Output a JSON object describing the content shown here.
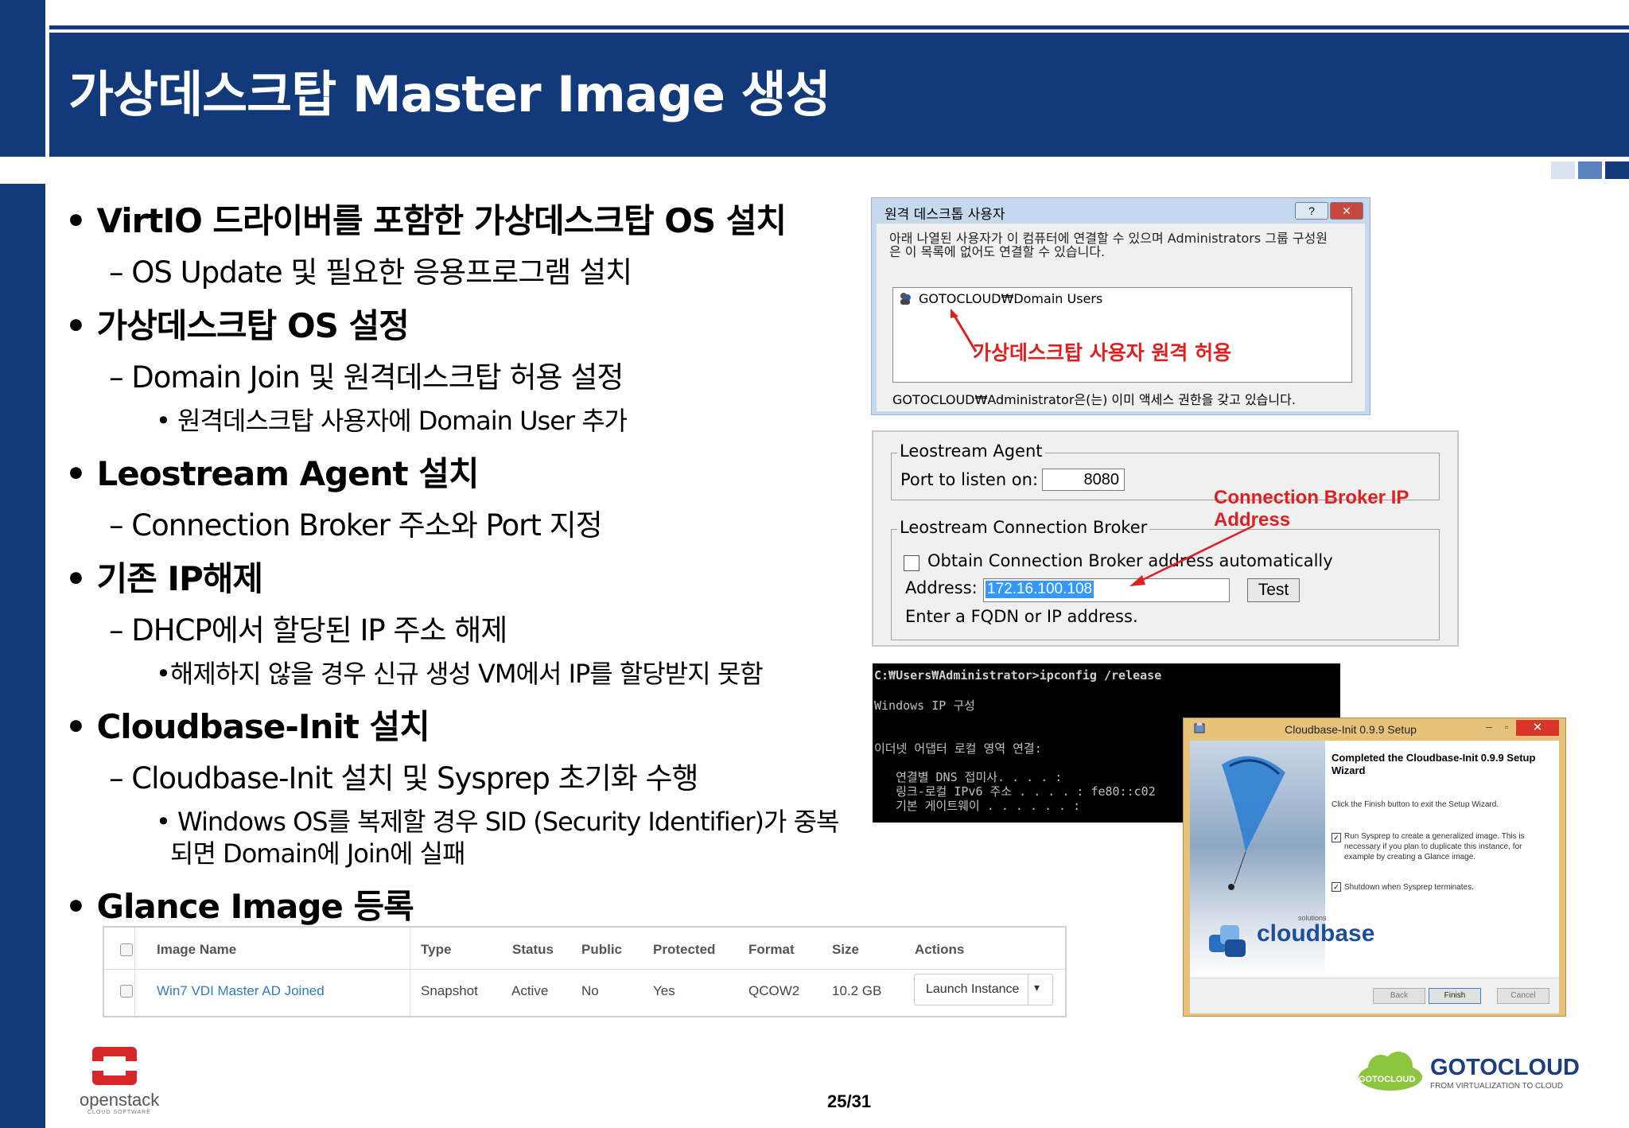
{
  "slide": {
    "title": "가상데스크탑 Master Image 생성",
    "page": "25/31"
  },
  "bullets": {
    "b1": "VirtIO 드라이버를 포함한 가상데스크탑 OS 설치",
    "b1_1": "– OS Update 및 필요한 응용프로그램 설치",
    "b2": "가상데스크탑 OS 설정",
    "b2_1": "– Domain Join 및 원격데스크탑 허용 설정",
    "b2_1_1": "원격데스크탑 사용자에 Domain User 추가",
    "b3": "Leostream Agent 설치",
    "b3_1": "– Connection Broker 주소와 Port 지정",
    "b4": "기존 IP해제",
    "b4_1": "– DHCP에서 할당된 IP 주소 해제",
    "b4_1_1": "해제하지 않을 경우 신규 생성 VM에서 IP를 할당받지 못함",
    "b5": "Cloudbase-Init 설치",
    "b5_1": "– Cloudbase-Init 설치 및 Sysprep 초기화 수행",
    "b5_1_1a": "Windows OS를 복제할 경우 SID (Security Identifier)가 중복",
    "b5_1_1b": "되면 Domain에 Join에 실패",
    "b6": "Glance Image 등록",
    "bullet_char": "•"
  },
  "rdp_dialog": {
    "title": "원격 데스크톱 사용자",
    "help": "?",
    "close": "✕",
    "desc": "아래 나열된 사용자가 이 컴퓨터에 연결할 수 있으며 Administrators 그룹 구성원은 이 목록에 없어도 연결할 수 있습니다.",
    "user": "GOTOCLOUD₩Domain Users",
    "annotation": "가상데스크탑 사용자 원격 허용",
    "footer": "GOTOCLOUD₩Administrator은(는) 이미 액세스 권한을 갖고 있습니다."
  },
  "leostream": {
    "agent_group": "Leostream Agent",
    "port_label": "Port to listen on:",
    "port_value": "8080",
    "broker_group": "Leostream Connection Broker",
    "obtain_label": "Obtain Connection Broker address automatically",
    "address_label": "Address:",
    "address_value": "172.16.100.108",
    "test_label": "Test",
    "hint": "Enter a FQDN or IP address.",
    "annotation": "Connection Broker IP Address"
  },
  "cmd": {
    "lines": [
      "C:₩Users₩Administrator>ipconfig /release",
      "",
      "Windows IP 구성",
      "",
      "",
      "이더넷 어댑터 로컬 영역 연결:",
      "",
      "   연결별 DNS 접미사. . . . :",
      "   링크-로컬 IPv6 주소 . . . . : fe80::c02",
      "   기본 게이트웨이 . . . . . . :"
    ]
  },
  "setup": {
    "title": "Cloudbase-Init 0.9.9 Setup",
    "heading": "Completed the Cloudbase-Init 0.9.9 Setup Wizard",
    "finish_text": "Click the Finish button to exit the Setup Wizard.",
    "opt1": "Run Sysprep to create a generalized image. This is necessary if you plan to duplicate this instance, for example by creating a Glance image.",
    "opt2": "Shutdown when Sysprep terminates.",
    "brand": "cloudbase",
    "brand_sup": "solutions",
    "back": "Back",
    "finish": "Finish",
    "cancel": "Cancel"
  },
  "glance_table": {
    "headers": [
      "Image Name",
      "Type",
      "Status",
      "Public",
      "Protected",
      "Format",
      "Size",
      "Actions"
    ],
    "row": {
      "name": "Win7 VDI Master AD Joined",
      "type": "Snapshot",
      "status": "Active",
      "public": "No",
      "protected": "Yes",
      "format": "QCOW2",
      "size": "10.2 GB",
      "action": "Launch Instance"
    }
  },
  "logos": {
    "openstack": "openstack",
    "openstack_sub": "CLOUD SOFTWARE",
    "gotocloud": "GOTOCLOUD",
    "gotocloud_sub": "FROM VIRTUALIZATION TO CLOUD",
    "gotocloud_badge": "GOTOCLOUD"
  },
  "colors": {
    "navy": "#123a7a",
    "annotation_red": "#e02020",
    "link_blue": "#2f7bbd"
  }
}
